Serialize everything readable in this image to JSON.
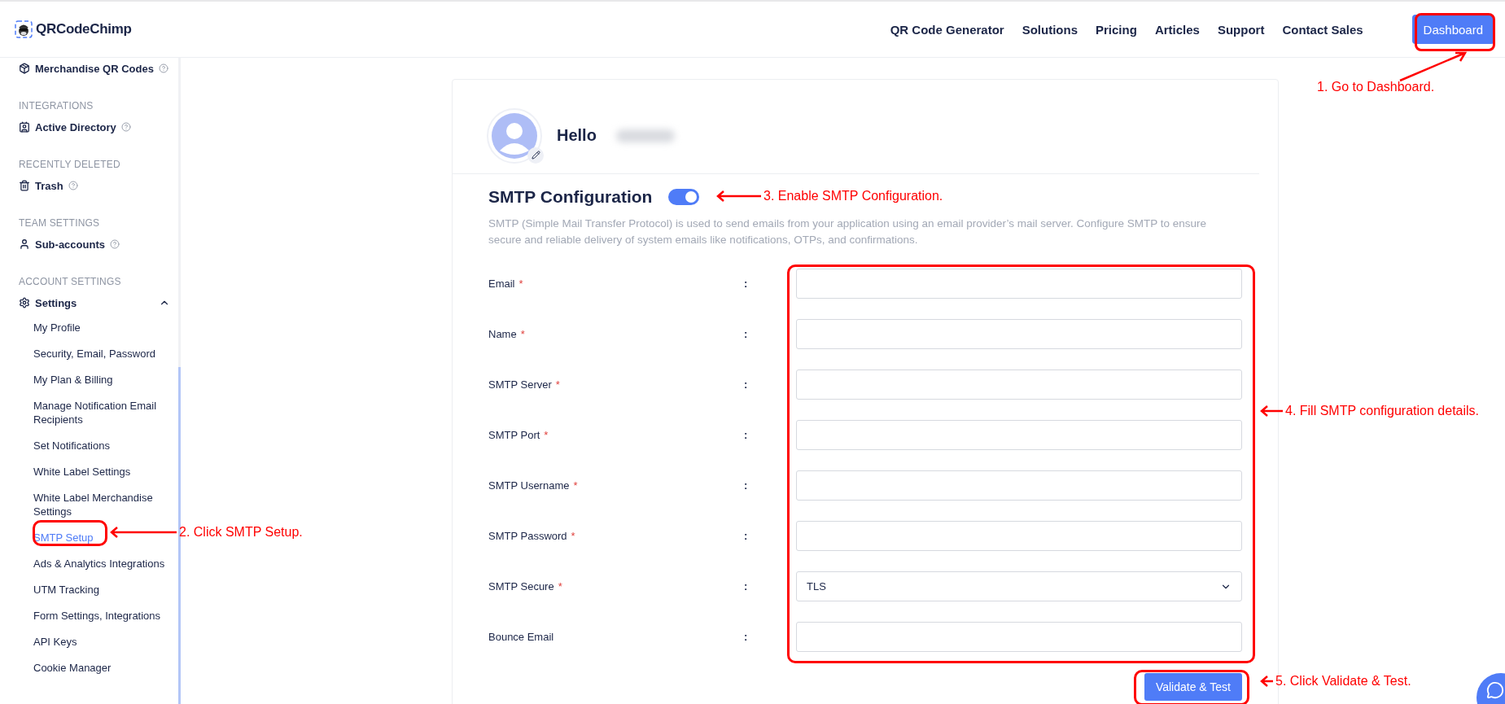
{
  "header": {
    "logo": "QRCodeChimp",
    "nav": [
      {
        "label": "QR Code Generator"
      },
      {
        "label": "Solutions"
      },
      {
        "label": "Pricing"
      },
      {
        "label": "Articles"
      },
      {
        "label": "Support"
      },
      {
        "label": "Contact Sales"
      }
    ],
    "dashboard_button": "Dashboard"
  },
  "sidebar": {
    "sections": [
      {
        "items": [
          {
            "label": "Merchandise QR Codes",
            "kind": "box",
            "help": true
          }
        ]
      },
      {
        "heading": "INTEGRATIONS",
        "items": [
          {
            "label": "Active Directory",
            "kind": "directory",
            "help": true
          }
        ]
      },
      {
        "heading": "RECENTLY DELETED",
        "items": [
          {
            "label": "Trash",
            "kind": "trash",
            "help": true
          }
        ]
      },
      {
        "heading": "TEAM SETTINGS",
        "items": [
          {
            "label": "Sub-accounts",
            "kind": "user",
            "help": true
          }
        ]
      },
      {
        "heading": "ACCOUNT SETTINGS",
        "items": [
          {
            "label": "Settings",
            "kind": "gear",
            "help": false,
            "expanded": true,
            "children": [
              {
                "label": "My Profile",
                "selected": false
              },
              {
                "label": "Security, Email, Password",
                "selected": false
              },
              {
                "label": "My Plan & Billing",
                "selected": false
              },
              {
                "label": "Manage Notification Email Recipients",
                "selected": false
              },
              {
                "label": "Set Notifications",
                "selected": false
              },
              {
                "label": "White Label Settings",
                "selected": false
              },
              {
                "label": "White Label Merchandise Settings",
                "selected": false
              },
              {
                "label": "SMTP Setup",
                "selected": true
              },
              {
                "label": "Ads & Analytics Integrations",
                "selected": false
              },
              {
                "label": "UTM Tracking",
                "selected": false
              },
              {
                "label": "Form Settings, Integrations",
                "selected": false
              },
              {
                "label": "API Keys",
                "selected": false
              },
              {
                "label": "Cookie Manager",
                "selected": false
              }
            ]
          }
        ]
      }
    ]
  },
  "profile": {
    "greeting": "Hello"
  },
  "smtp": {
    "title": "SMTP Configuration",
    "enabled": true,
    "description": "SMTP (Simple Mail Transfer Protocol) is used to send emails from your application using an email provider’s mail server. Configure SMTP to ensure secure and reliable delivery of system emails like notifications, OTPs, and confirmations.",
    "fields": [
      {
        "label": "Email",
        "required_mark": "*",
        "separator": ":",
        "kind": "text"
      },
      {
        "label": "Name",
        "required_mark": "*",
        "separator": ":",
        "kind": "text"
      },
      {
        "label": "SMTP Server",
        "required_mark": "*",
        "separator": ":",
        "kind": "text"
      },
      {
        "label": "SMTP Port",
        "required_mark": "*",
        "separator": ":",
        "kind": "text"
      },
      {
        "label": "SMTP Username",
        "required_mark": "*",
        "separator": ":",
        "kind": "text"
      },
      {
        "label": "SMTP Password",
        "required_mark": "*",
        "separator": ":",
        "kind": "text"
      },
      {
        "label": "SMTP Secure",
        "required_mark": "*",
        "separator": ":",
        "kind": "select",
        "value": "TLS"
      },
      {
        "label": "Bounce Email",
        "separator": ":",
        "kind": "text"
      }
    ],
    "submit": "Validate & Test"
  },
  "annotations": [
    {
      "text": "1. Go to Dashboard."
    },
    {
      "text": "2. Click SMTP Setup."
    },
    {
      "text": "3. Enable SMTP Configuration."
    },
    {
      "text": "4. Fill SMTP configuration details."
    },
    {
      "text": "5. Click Validate & Test."
    }
  ]
}
